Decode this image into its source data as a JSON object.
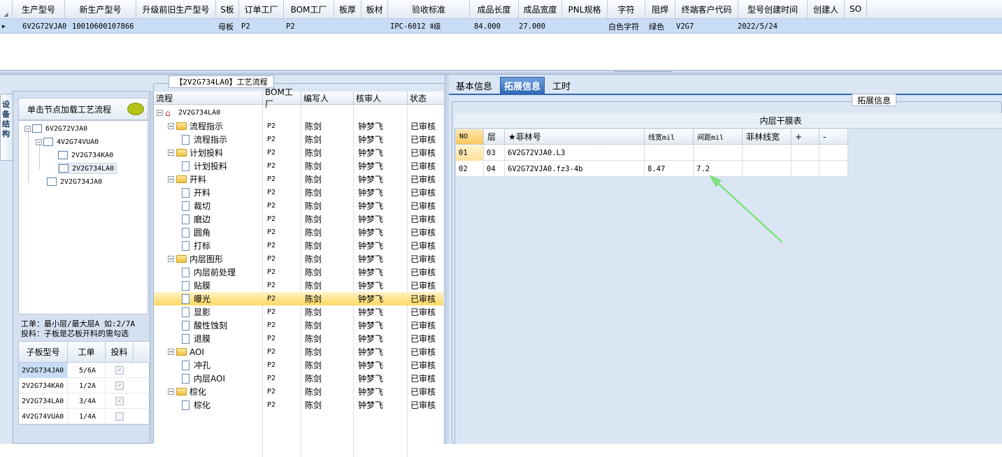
{
  "top_grid": {
    "columns": [
      "生产型号",
      "新生产型号",
      "升级前旧生产型号",
      "S板",
      "订单工厂",
      "BOM工厂",
      "板厚",
      "板材",
      "验收标准",
      "成品长度",
      "成品宽度",
      "PNL规格",
      "字符",
      "阻焊",
      "终端客户代码",
      "型号创建时间",
      "创建人",
      "SO"
    ],
    "row": {
      "production_model": "6V2G72VJA0",
      "new_model": "10010600107866",
      "old_model": "",
      "s_board": "母板",
      "order_factory": "P2",
      "bom_factory": "P2",
      "thickness": "",
      "material": "",
      "standard": "IPC-6012 Ⅱ级",
      "length": "84.000",
      "width": "27.000",
      "pnl": "",
      "silkscreen": "白色字符",
      "soldermask": "绿色",
      "customer_code": "V2G7",
      "created": "2022/5/24",
      "creator": "",
      "so": ""
    }
  },
  "left_panel": {
    "vertical_tab": "设备结构",
    "load_button": "单击节点加载工艺流程",
    "tree": [
      {
        "label": "6V2G72VJA0",
        "level": 0
      },
      {
        "label": "4V2G74VUA0",
        "level": 1
      },
      {
        "label": "2V2G734KA0",
        "level": 2
      },
      {
        "label": "2V2G734LA0",
        "level": 2
      },
      {
        "label": "2V2G734JA0",
        "level": 1
      }
    ],
    "hint_line1": "工单：最小层/最大层A 如:2/7A",
    "hint_line2": "投料：子板是芯板开料的需勾选",
    "subgrid": {
      "headers": [
        "子板型号",
        "工单",
        "投料"
      ],
      "rows": [
        {
          "model": "2V2G734JA0",
          "order": "5/6A",
          "checked": true
        },
        {
          "model": "2V2G734KA0",
          "order": "1/2A",
          "checked": true
        },
        {
          "model": "2V2G734LA0",
          "order": "3/4A",
          "checked": true
        },
        {
          "model": "4V2G74VUA0",
          "order": "1/4A",
          "checked": false
        }
      ]
    }
  },
  "process_panel": {
    "title": "【2V2G734LA0】工艺流程",
    "headers": [
      "流程",
      "BOM工厂",
      "编写人",
      "核审人",
      "状态"
    ],
    "root": "2V2G734LA0",
    "rows": [
      {
        "name": "流程指示",
        "type": "folder",
        "bom": "P2",
        "writer": "陈剑",
        "reviewer": "钟梦飞",
        "status": "已审核"
      },
      {
        "name": "流程指示",
        "type": "doc",
        "bom": "P2",
        "writer": "陈剑",
        "reviewer": "钟梦飞",
        "status": "已审核"
      },
      {
        "name": "计划投料",
        "type": "folder",
        "bom": "P2",
        "writer": "陈剑",
        "reviewer": "钟梦飞",
        "status": "已审核"
      },
      {
        "name": "计划投料",
        "type": "doc",
        "bom": "P2",
        "writer": "陈剑",
        "reviewer": "钟梦飞",
        "status": "已审核"
      },
      {
        "name": "开料",
        "type": "folder",
        "bom": "P2",
        "writer": "陈剑",
        "reviewer": "钟梦飞",
        "status": "已审核"
      },
      {
        "name": "开料",
        "type": "doc",
        "bom": "P2",
        "writer": "陈剑",
        "reviewer": "钟梦飞",
        "status": "已审核"
      },
      {
        "name": "裁切",
        "type": "doc",
        "bom": "P2",
        "writer": "陈剑",
        "reviewer": "钟梦飞",
        "status": "已审核"
      },
      {
        "name": "磨边",
        "type": "doc",
        "bom": "P2",
        "writer": "陈剑",
        "reviewer": "钟梦飞",
        "status": "已审核"
      },
      {
        "name": "圆角",
        "type": "doc",
        "bom": "P2",
        "writer": "陈剑",
        "reviewer": "钟梦飞",
        "status": "已审核"
      },
      {
        "name": "打标",
        "type": "doc",
        "bom": "P2",
        "writer": "陈剑",
        "reviewer": "钟梦飞",
        "status": "已审核"
      },
      {
        "name": "内层图形",
        "type": "folder",
        "bom": "P2",
        "writer": "陈剑",
        "reviewer": "钟梦飞",
        "status": "已审核"
      },
      {
        "name": "内层前处理",
        "type": "doc",
        "bom": "P2",
        "writer": "陈剑",
        "reviewer": "钟梦飞",
        "status": "已审核"
      },
      {
        "name": "贴膜",
        "type": "doc",
        "bom": "P2",
        "writer": "陈剑",
        "reviewer": "钟梦飞",
        "status": "已审核"
      },
      {
        "name": "曝光",
        "type": "doc",
        "bom": "P2",
        "writer": "陈剑",
        "reviewer": "钟梦飞",
        "status": "已审核",
        "selected": true
      },
      {
        "name": "显影",
        "type": "doc",
        "bom": "P2",
        "writer": "陈剑",
        "reviewer": "钟梦飞",
        "status": "已审核"
      },
      {
        "name": "酸性蚀刻",
        "type": "doc",
        "bom": "P2",
        "writer": "陈剑",
        "reviewer": "钟梦飞",
        "status": "已审核"
      },
      {
        "name": "退膜",
        "type": "doc",
        "bom": "P2",
        "writer": "陈剑",
        "reviewer": "钟梦飞",
        "status": "已审核"
      },
      {
        "name": "AOI",
        "type": "folder",
        "bom": "P2",
        "writer": "陈剑",
        "reviewer": "钟梦飞",
        "status": "已审核"
      },
      {
        "name": "冲孔",
        "type": "doc",
        "bom": "P2",
        "writer": "陈剑",
        "reviewer": "钟梦飞",
        "status": "已审核"
      },
      {
        "name": "内层AOI",
        "type": "doc",
        "bom": "P2",
        "writer": "陈剑",
        "reviewer": "钟梦飞",
        "status": "已审核"
      },
      {
        "name": "棕化",
        "type": "folder",
        "bom": "P2",
        "writer": "陈剑",
        "reviewer": "钟梦飞",
        "status": "已审核"
      },
      {
        "name": "棕化",
        "type": "doc",
        "bom": "P2",
        "writer": "陈剑",
        "reviewer": "钟梦飞",
        "status": "已审核"
      }
    ]
  },
  "right_panel": {
    "tabs": [
      "基本信息",
      "拓展信息",
      "工时"
    ],
    "active_tab": "拓展信息",
    "group_title": "拓展信息",
    "table_title": "内层干膜表",
    "headers": [
      "NO",
      "层",
      "★菲林号",
      "线宽mil",
      "间距mil",
      "菲林线宽",
      "+",
      "-"
    ],
    "rows": [
      {
        "no": "01",
        "layer": "03",
        "film": "6V2G72VJA0.L3",
        "width": "",
        "spacing": "",
        "film_width": ""
      },
      {
        "no": "02",
        "layer": "04",
        "film": "6V2G72VJA0.fz3-4b",
        "width": "8.47",
        "spacing": "7.2",
        "film_width": ""
      }
    ],
    "annotation_color": "#7ee07e"
  }
}
